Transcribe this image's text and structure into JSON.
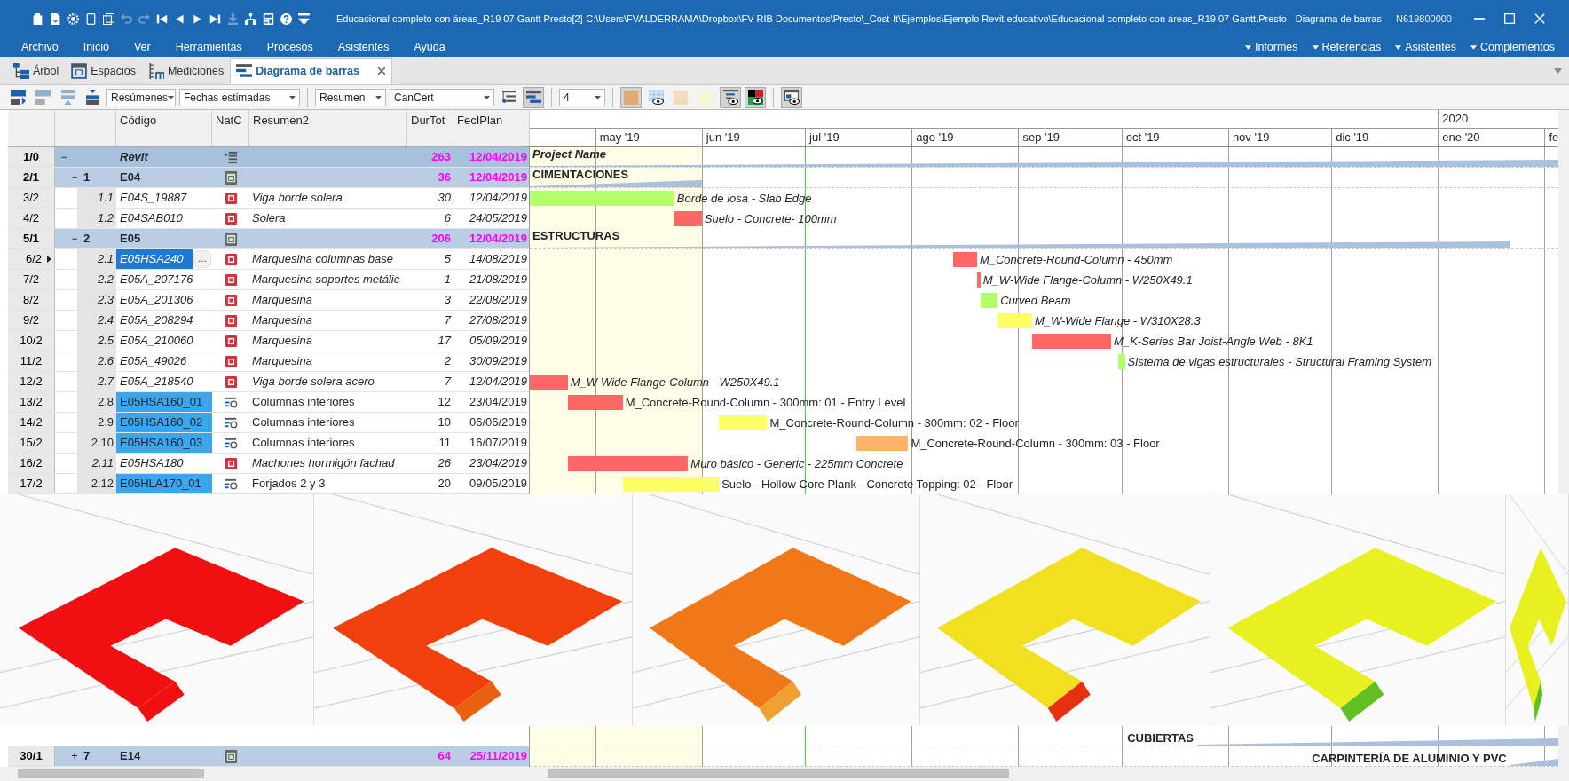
{
  "window": {
    "title": "Educacional completo con áreas_R19 07 Gantt Presto[2]-C:\\Users\\FVALDERRAMA\\Dropbox\\FV RIB Documentos\\Presto\\_Cost-It\\Ejemplos\\Ejemplo Revit educativo\\Educacional completo con áreas_R19 07 Gantt.Presto - Diagrama de barras",
    "license": "N619800000"
  },
  "quick_access": [
    {
      "kind": "clipboard",
      "disabled": false
    },
    {
      "kind": "document",
      "disabled": false
    },
    {
      "kind": "gear",
      "disabled": false
    },
    {
      "kind": "tablet",
      "disabled": false
    },
    {
      "kind": "copy",
      "disabled": false
    },
    {
      "kind": "undo",
      "disabled": true
    },
    {
      "kind": "redo",
      "disabled": true
    },
    {
      "kind": "first",
      "disabled": false
    },
    {
      "kind": "previous",
      "disabled": false
    },
    {
      "kind": "next",
      "disabled": false
    },
    {
      "kind": "last",
      "disabled": false
    },
    {
      "kind": "download",
      "disabled": true
    },
    {
      "kind": "hierarchy",
      "disabled": false
    },
    {
      "kind": "calculator",
      "disabled": false
    },
    {
      "kind": "help",
      "disabled": false
    },
    {
      "kind": "customize",
      "disabled": false
    }
  ],
  "menu": [
    "Archivo",
    "Inicio",
    "Ver",
    "Herramientas",
    "Procesos",
    "Asistentes",
    "Ayuda"
  ],
  "menu_right": [
    "Informes",
    "Referencias",
    "Asistentes",
    "Complementos"
  ],
  "tabs": [
    {
      "label": "Árbol",
      "kind": "tree",
      "selected": false,
      "closable": false
    },
    {
      "label": "Espacios",
      "kind": "spaces",
      "selected": false,
      "closable": false
    },
    {
      "label": "Mediciones",
      "kind": "ruler",
      "selected": false,
      "closable": false
    },
    {
      "label": "Diagrama de barras",
      "kind": "bars",
      "selected": true,
      "closable": true
    }
  ],
  "toolbar": [
    {
      "kind": "button",
      "pressed": false,
      "disabled": false
    },
    {
      "kind": "button",
      "pressed": false,
      "disabled": true
    },
    {
      "kind": "button",
      "pressed": false,
      "disabled": true
    },
    {
      "kind": "button",
      "pressed": false,
      "disabled": false
    },
    {
      "kind": "dropdown",
      "value": "Resúmenes"
    },
    {
      "kind": "dropdown",
      "value": "Fechas estimadas"
    },
    {
      "kind": "separator"
    },
    {
      "kind": "dropdown",
      "value": "Resumen"
    },
    {
      "kind": "dropdown",
      "value": "CanCert"
    },
    {
      "kind": "button",
      "pressed": false,
      "disabled": false
    },
    {
      "kind": "button",
      "pressed": true,
      "disabled": false
    },
    {
      "kind": "separator"
    },
    {
      "kind": "dropdown",
      "value": "4"
    },
    {
      "kind": "separator"
    },
    {
      "kind": "swatch",
      "color": "#e2aa6e",
      "pressed": true,
      "disabled": false
    },
    {
      "kind": "button",
      "pressed": false,
      "disabled": false
    },
    {
      "kind": "swatch",
      "color": "#f5dcbd",
      "pressed": false,
      "disabled": false
    },
    {
      "kind": "swatch",
      "color": "#f8f4d6",
      "pressed": false,
      "disabled": false
    },
    {
      "kind": "button",
      "pressed": true,
      "disabled": false
    },
    {
      "kind": "button",
      "pressed": true,
      "disabled": false
    },
    {
      "kind": "separator"
    },
    {
      "kind": "button",
      "pressed": true,
      "disabled": false
    }
  ],
  "table": {
    "columns": [
      "Código",
      "NatC",
      "Resumen2",
      "DurTot",
      "FecIPlan"
    ],
    "rows": [
      {
        "num": "1/0",
        "toggle": "−",
        "code": "Revit",
        "kind": "root",
        "dur": "263",
        "date": "12/04/2019",
        "selected": false,
        "children": [
          {
            "num": "2/1",
            "toggle": "−",
            "index": "1",
            "code": "E04",
            "kind": "chapter",
            "dur": "36",
            "date": "12/04/2019",
            "selected": false,
            "children": [
              {
                "num": "3/2",
                "index": "1.1",
                "code": "E04S_19887",
                "kind": "element",
                "summary": "Viga borde solera",
                "dur": "30",
                "date": "12/04/2019",
                "selected": false
              },
              {
                "num": "4/2",
                "index": "1.2",
                "code": "E04SAB010",
                "kind": "element",
                "summary": "Solera",
                "dur": "6",
                "date": "24/05/2019",
                "selected": false
              }
            ]
          },
          {
            "num": "5/1",
            "toggle": "−",
            "index": "2",
            "code": "E05",
            "kind": "chapter",
            "dur": "206",
            "date": "12/04/2019",
            "selected": false,
            "children": [
              {
                "num": "6/2",
                "index": "2.1",
                "code": "E05HSA240",
                "kind": "element",
                "summary": "Marquesina columnas base",
                "dur": "5",
                "date": "14/08/2019",
                "selected": true,
                "edit_button": "…"
              },
              {
                "num": "7/2",
                "index": "2.2",
                "code": "E05A_207176",
                "kind": "element",
                "summary": "Marquesina soportes metálic",
                "dur": "1",
                "date": "21/08/2019",
                "selected": false
              },
              {
                "num": "8/2",
                "index": "2.3",
                "code": "E05A_201306",
                "kind": "element",
                "summary": "Marquesina",
                "dur": "3",
                "date": "22/08/2019",
                "selected": false
              },
              {
                "num": "9/2",
                "index": "2.4",
                "code": "E05A_208294",
                "kind": "element",
                "summary": "Marquesina",
                "dur": "7",
                "date": "27/08/2019",
                "selected": false
              },
              {
                "num": "10/2",
                "index": "2.5",
                "code": "E05A_210060",
                "kind": "element",
                "summary": "Marquesina",
                "dur": "17",
                "date": "05/09/2019",
                "selected": false
              },
              {
                "num": "11/2",
                "index": "2.6",
                "code": "E05A_49026",
                "kind": "element",
                "summary": "Marquesina",
                "dur": "2",
                "date": "30/09/2019",
                "selected": false
              },
              {
                "num": "12/2",
                "index": "2.7",
                "code": "E05A_218540",
                "kind": "element",
                "summary": "Viga borde solera acero",
                "dur": "7",
                "date": "12/04/2019",
                "selected": false
              },
              {
                "num": "13/2",
                "index": "2.8",
                "code": "E05HSA160_01",
                "kind": "composite",
                "summary": "Columnas interiores",
                "dur": "12",
                "date": "23/04/2019",
                "selected": false
              },
              {
                "num": "14/2",
                "index": "2.9",
                "code": "E05HSA160_02",
                "kind": "composite",
                "summary": "Columnas interiores",
                "dur": "10",
                "date": "06/06/2019",
                "selected": false
              },
              {
                "num": "15/2",
                "index": "2.10",
                "code": "E05HSA160_03",
                "kind": "composite",
                "summary": "Columnas interiores",
                "dur": "11",
                "date": "16/07/2019",
                "selected": false
              },
              {
                "num": "16/2",
                "index": "2.11",
                "code": "E05HSA180",
                "kind": "element",
                "summary": "Machones hormigón fachad",
                "dur": "26",
                "date": "23/04/2019",
                "selected": false
              },
              {
                "num": "17/2",
                "index": "2.12",
                "code": "E05HLA170_01",
                "kind": "composite",
                "summary": "Forjados 2 y 3",
                "dur": "20",
                "date": "09/05/2019",
                "selected": false
              }
            ]
          }
        ]
      }
    ],
    "rows_below": [
      {
        "num": "30/1",
        "toggle": "+",
        "index": "7",
        "code": "E14",
        "kind": "chapter",
        "dur": "64",
        "date": "25/11/2019",
        "selected": false
      }
    ]
  },
  "gantt": {
    "year": "2020",
    "months": [
      "may '19",
      "jun '19",
      "jul '19",
      "ago '19",
      "sep '19",
      "oct '19",
      "nov '19",
      "dic '19",
      "ene '20",
      "fe"
    ],
    "rows": [
      {
        "kind": "summary",
        "label": "Project Name",
        "italic": true
      },
      {
        "kind": "summary",
        "label": "CIMENTACIONES",
        "italic": false
      },
      {
        "kind": "task",
        "label": "Borde de losa - Slab Edge",
        "italic": true,
        "color": "#b3ff66"
      },
      {
        "kind": "task",
        "label": "Suelo - Concrete- 100mm",
        "italic": true,
        "color": "#ff6666"
      },
      {
        "kind": "summary",
        "label": "ESTRUCTURAS",
        "italic": false
      },
      {
        "kind": "task",
        "label": "M_Concrete-Round-Column - 450mm",
        "italic": true,
        "color": "#ff6666"
      },
      {
        "kind": "task",
        "label": "M_W-Wide Flange-Column - W250X49.1",
        "italic": true,
        "color": "#ff6666"
      },
      {
        "kind": "task",
        "label": "Curved Beam",
        "italic": true,
        "color": "#b3ff66"
      },
      {
        "kind": "task",
        "label": "M_W-Wide Flange - W310X28.3",
        "italic": true,
        "color": "#ffff66"
      },
      {
        "kind": "task",
        "label": "M_K-Series Bar Joist-Angle Web - 8K1",
        "italic": true,
        "color": "#ff6666"
      },
      {
        "kind": "task",
        "label": "Sistema de vigas estructurales - Structural Framing System",
        "italic": true,
        "color": "#b3ff66"
      },
      {
        "kind": "task",
        "label": "M_W-Wide Flange-Column - W250X49.1",
        "italic": true,
        "color": "#ff6666"
      },
      {
        "kind": "task",
        "label": "M_Concrete-Round-Column - 300mm: 01 - Entry Level",
        "italic": false,
        "color": "#ff6666"
      },
      {
        "kind": "task",
        "label": "M_Concrete-Round-Column - 300mm: 02 - Floor",
        "italic": false,
        "color": "#ffff66"
      },
      {
        "kind": "task",
        "label": "M_Concrete-Round-Column - 300mm: 03 - Floor",
        "italic": false,
        "color": "#ffb366"
      },
      {
        "kind": "task",
        "label": "Muro básico - Generic - 225mm Concrete",
        "italic": true,
        "color": "#ff6666"
      },
      {
        "kind": "task",
        "label": "Suelo - Hollow Core Plank - Concrete Topping: 02 - Floor",
        "italic": false,
        "color": "#ffff66"
      }
    ],
    "rows_below": [
      {
        "kind": "summary",
        "label": "CUBIERTAS",
        "italic": false
      },
      {
        "kind": "summary",
        "label": "CARPINTERÍA DE ALUMINIO Y PVC",
        "italic": false
      }
    ]
  }
}
